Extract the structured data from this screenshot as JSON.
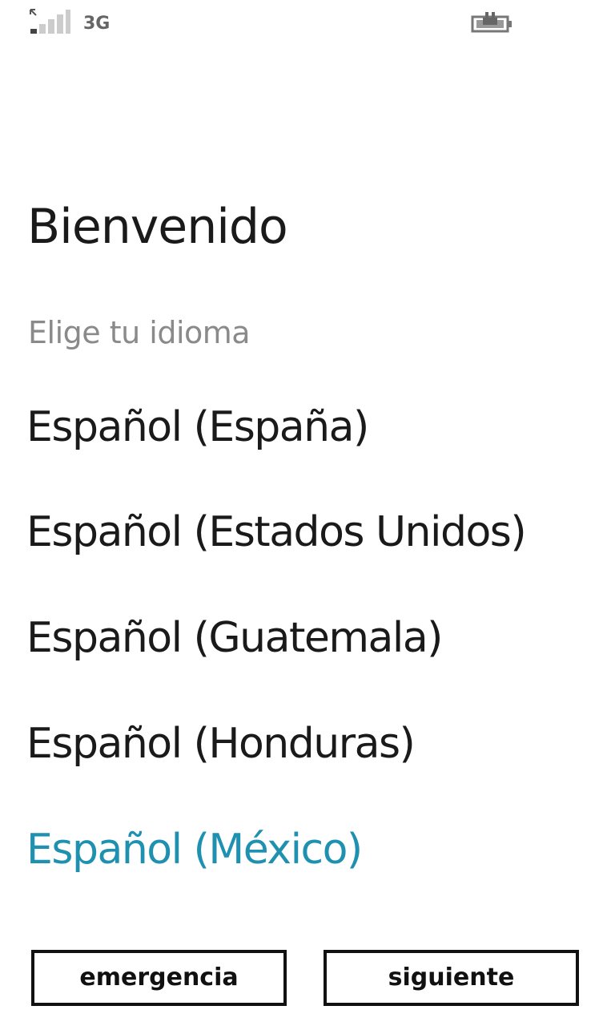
{
  "status_bar": {
    "network_type": "3G",
    "signal_icon": "signal-strength-icon",
    "battery_icon": "battery-charging-icon",
    "signal_bars_active": 1,
    "signal_bars_total": 4
  },
  "header": {
    "title": "Bienvenido",
    "subtitle": "Elige tu idioma"
  },
  "languages": [
    {
      "label": "Español (España)",
      "selected": false
    },
    {
      "label": "Español (Estados Unidos)",
      "selected": false
    },
    {
      "label": "Español (Guatemala)",
      "selected": false
    },
    {
      "label": "Español (Honduras)",
      "selected": false
    },
    {
      "label": "Español (México)",
      "selected": true
    }
  ],
  "buttons": {
    "emergency_label": "emergencia",
    "next_label": "siguiente"
  },
  "colors": {
    "accent": "#1e90b0",
    "text": "#1a1a1a",
    "muted": "#8a8a8a"
  }
}
